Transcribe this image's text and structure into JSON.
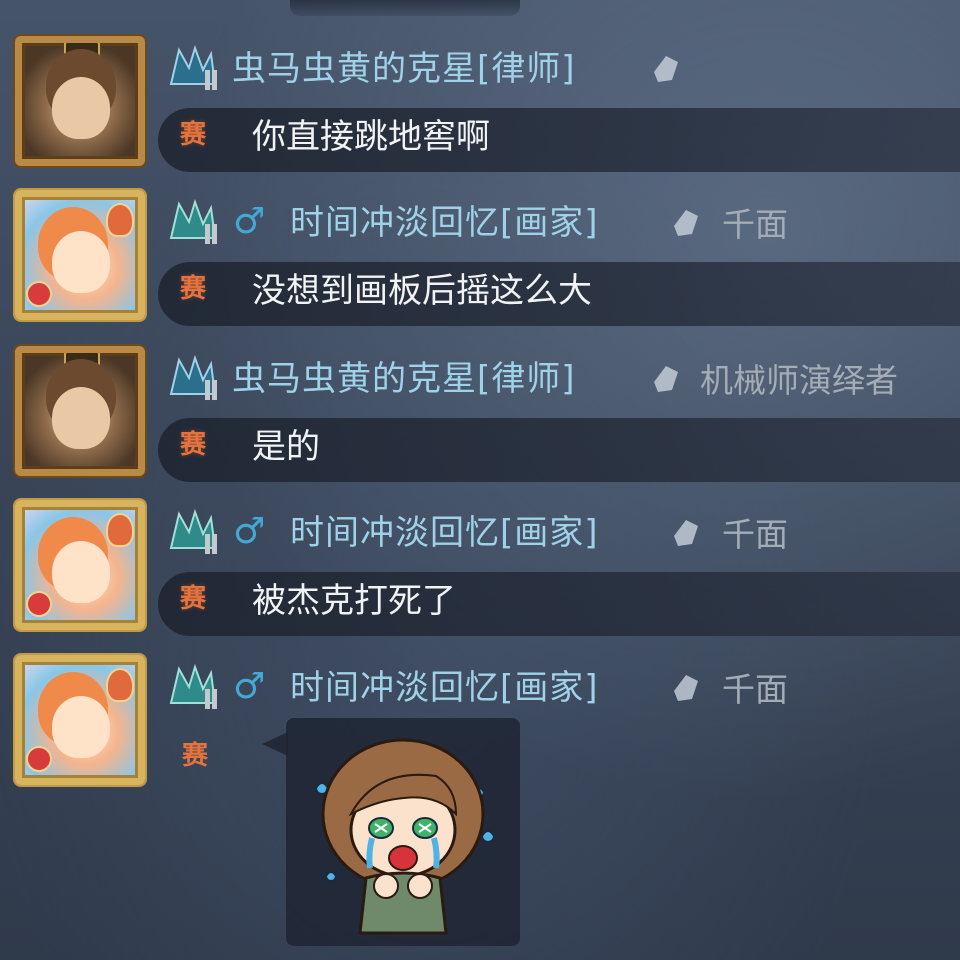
{
  "badge_label": "赛",
  "messages": [
    {
      "avatar": "lawyer-avatar",
      "username": "虫马虫黄的克星[律师]",
      "gender_icon": "",
      "title": "",
      "text": "你直接跳地窖啊"
    },
    {
      "avatar": "painter-avatar",
      "username": "时间冲淡回忆[画家]",
      "gender_icon": "♂",
      "title": "千面",
      "text": "没想到画板后摇这么大"
    },
    {
      "avatar": "lawyer-avatar",
      "username": "虫马虫黄的克星[律师]",
      "gender_icon": "",
      "title": "机械师演绎者",
      "text": "是的"
    },
    {
      "avatar": "painter-avatar",
      "username": "时间冲淡回忆[画家]",
      "gender_icon": "♂",
      "title": "千面",
      "text": "被杰克打死了"
    },
    {
      "avatar": "painter-avatar",
      "username": "时间冲淡回忆[画家]",
      "gender_icon": "♂",
      "title": "千面",
      "sticker": "crying-character-sticker"
    }
  ],
  "colors": {
    "username": "#9fd2e8",
    "badge": "#e5733b",
    "gender": "#43a8d6",
    "title": "#a4acb6",
    "message_text": "#f2f3f5"
  }
}
